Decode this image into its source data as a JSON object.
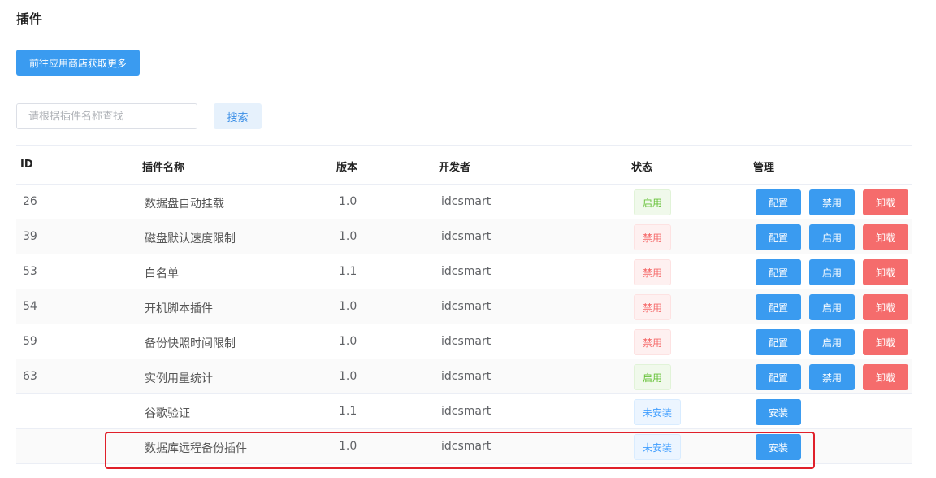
{
  "page": {
    "title": "插件"
  },
  "toolbar": {
    "store_label": "前往应用商店获取更多"
  },
  "search": {
    "placeholder": "请根据插件名称查找",
    "value": "",
    "button_label": "搜索"
  },
  "table": {
    "headers": {
      "id": "ID",
      "name": "插件名称",
      "version": "版本",
      "developer": "开发者",
      "status": "状态",
      "manage": "管理"
    },
    "rows": [
      {
        "id": "26",
        "name": "数据盘自动挂载",
        "version": "1.0",
        "developer": "idcsmart",
        "status": "启用",
        "status_type": "on",
        "actions": [
          "配置",
          "禁用",
          "卸载"
        ]
      },
      {
        "id": "39",
        "name": "磁盘默认速度限制",
        "version": "1.0",
        "developer": "idcsmart",
        "status": "禁用",
        "status_type": "off",
        "actions": [
          "配置",
          "启用",
          "卸载"
        ]
      },
      {
        "id": "53",
        "name": "白名单",
        "version": "1.1",
        "developer": "idcsmart",
        "status": "禁用",
        "status_type": "off",
        "actions": [
          "配置",
          "启用",
          "卸载"
        ]
      },
      {
        "id": "54",
        "name": "开机脚本插件",
        "version": "1.0",
        "developer": "idcsmart",
        "status": "禁用",
        "status_type": "off",
        "actions": [
          "配置",
          "启用",
          "卸载"
        ]
      },
      {
        "id": "59",
        "name": "备份快照时间限制",
        "version": "1.0",
        "developer": "idcsmart",
        "status": "禁用",
        "status_type": "off",
        "actions": [
          "配置",
          "启用",
          "卸载"
        ]
      },
      {
        "id": "63",
        "name": "实例用量统计",
        "version": "1.0",
        "developer": "idcsmart",
        "status": "启用",
        "status_type": "on",
        "actions": [
          "配置",
          "禁用",
          "卸载"
        ]
      },
      {
        "id": "",
        "name": "谷歌验证",
        "version": "1.1",
        "developer": "idcsmart",
        "status": "未安装",
        "status_type": "none",
        "actions": [
          "安装"
        ]
      },
      {
        "id": "",
        "name": "数据库远程备份插件",
        "version": "1.0",
        "developer": "idcsmart",
        "status": "未安装",
        "status_type": "none",
        "actions": [
          "安装"
        ]
      }
    ]
  },
  "colors": {
    "primary": "#3a9bf0",
    "danger": "#f56c6c",
    "success": "#67c23a",
    "highlight": "#e0202a"
  }
}
